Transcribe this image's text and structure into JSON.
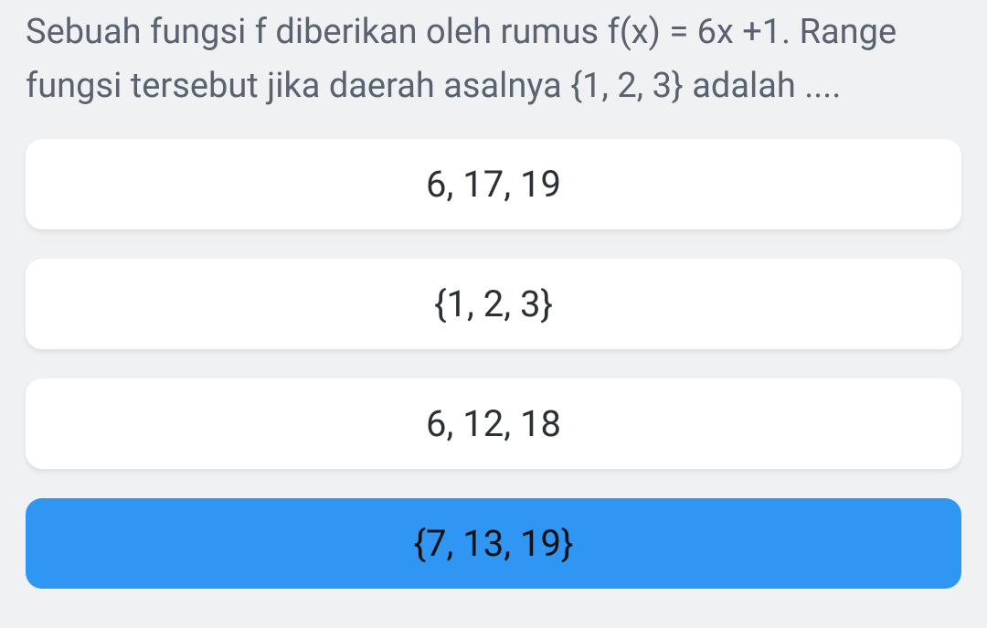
{
  "question": "Sebuah fungsi f diberikan oleh rumus f(x) = 6x +1. Range fungsi tersebut jika daerah asalnya {1, 2, 3} adalah ....",
  "options": [
    {
      "label": "6, 17, 19",
      "selected": false
    },
    {
      "label": "{1, 2, 3}",
      "selected": false
    },
    {
      "label": "6, 12, 18",
      "selected": false
    },
    {
      "label": "{7, 13, 19}",
      "selected": true
    }
  ]
}
